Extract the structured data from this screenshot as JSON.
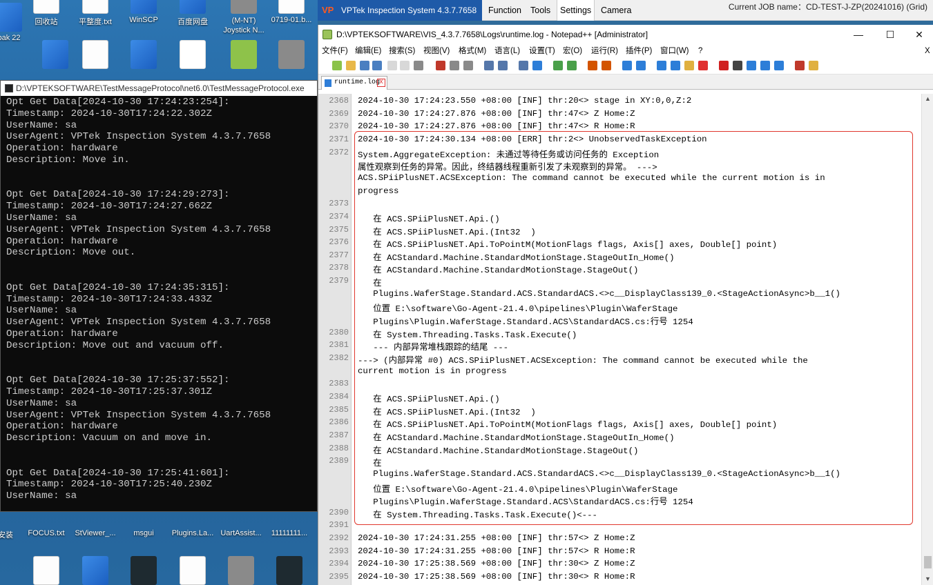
{
  "desktop": {
    "icons": [
      {
        "label": "bak\n22",
        "kind": "blue"
      },
      {
        "label": "回收站",
        "kind": "file"
      },
      {
        "label": "平整度.txt",
        "kind": "file"
      },
      {
        "label": "WinSCP",
        "kind": "blue"
      },
      {
        "label": "百度网盘",
        "kind": "blue"
      },
      {
        "label": "(M-NT)\nJoystick N...",
        "kind": "gray"
      },
      {
        "label": "0719-01.b...",
        "kind": "file"
      },
      {
        "label": "安装",
        "kind": "blue"
      },
      {
        "label": "FOCUS.txt",
        "kind": "file"
      },
      {
        "label": "StViewer_...",
        "kind": "blue"
      },
      {
        "label": "msgui",
        "kind": "dark"
      },
      {
        "label": "Plugins.La...",
        "kind": "file"
      },
      {
        "label": "UartAssist...",
        "kind": "gray"
      },
      {
        "label": "11111111...",
        "kind": "dark"
      }
    ]
  },
  "console": {
    "title": "D:\\VPTEKSOFTWARE\\TestMessageProtocol\\net6.0\\TestMessageProtocol.exe",
    "lines": [
      "Opt Get Data[2024-10-30 17:24:23:254]:",
      "Timestamp: 2024-10-30T17:24:22.302Z",
      "UserName: sa",
      "UserAgent: VPTek Inspection System 4.3.7.7658",
      "Operation: hardware",
      "Description: Move in.",
      "",
      "",
      "Opt Get Data[2024-10-30 17:24:29:273]:",
      "Timestamp: 2024-10-30T17:24:27.662Z",
      "UserName: sa",
      "UserAgent: VPTek Inspection System 4.3.7.7658",
      "Operation: hardware",
      "Description: Move out.",
      "",
      "",
      "Opt Get Data[2024-10-30 17:24:35:315]:",
      "Timestamp: 2024-10-30T17:24:33.433Z",
      "UserName: sa",
      "UserAgent: VPTek Inspection System 4.3.7.7658",
      "Operation: hardware",
      "Description: Move out and vacuum off.",
      "",
      "",
      "Opt Get Data[2024-10-30 17:25:37:552]:",
      "Timestamp: 2024-10-30T17:25:37.301Z",
      "UserName: sa",
      "UserAgent: VPTek Inspection System 4.3.7.7658",
      "Operation: hardware",
      "Description: Vacuum on and move in.",
      "",
      "",
      "Opt Get Data[2024-10-30 17:25:41:601]:",
      "Timestamp: 2024-10-30T17:25:40.230Z",
      "UserName: sa"
    ]
  },
  "vptek": {
    "title": "VPTek Inspection System 4.3.7.7658",
    "logo": "VP",
    "menus": [
      "Function",
      "Tools",
      "Settings",
      "Camera"
    ],
    "selected_menu": "Settings",
    "job": "Current JOB name：CD-TEST-J-ZP(20241016) (Grid)"
  },
  "npp": {
    "title": "D:\\VPTEKSOFTWARE\\VIS_4.3.7.7658\\Logs\\runtime.log - Notepad++ [Administrator]",
    "window_controls": [
      "—",
      "☐",
      "✕"
    ],
    "menu": [
      "文件(F)",
      "编辑(E)",
      "搜索(S)",
      "视图(V)",
      "格式(M)",
      "语言(L)",
      "设置(T)",
      "宏(O)",
      "运行(R)",
      "插件(P)",
      "窗口(W)",
      "?"
    ],
    "menu_close": "X",
    "tab": "runtime.log",
    "tab_close": "x"
  },
  "log": [
    {
      "n": "2368",
      "text": "2024-10-30 17:24:23.550 +08:00 [INF] thr:20<> stage in XY:0,0,Z:2"
    },
    {
      "n": "2369",
      "text": "2024-10-30 17:24:27.876 +08:00 [INF] thr:47<> Z Home:Z"
    },
    {
      "n": "2370",
      "text": "2024-10-30 17:24:27.876 +08:00 [INF] thr:47<> R Home:R"
    },
    {
      "n": "2371",
      "text": "2024-10-30 17:24:30.134 +08:00 [ERR] thr:2<> UnobservedTaskException"
    },
    {
      "n": "2372",
      "text": "System.AggregateException: 未通过等待任务或访问任务的 Exception"
    },
    {
      "n": "",
      "text": "属性观察到任务的异常。因此，终结器线程重新引发了未观察到的异常。 --->"
    },
    {
      "n": "",
      "text": "ACS.SPiiPlusNET.ACSException: The command cannot be executed while the current motion is in"
    },
    {
      "n": "",
      "text": "progress"
    },
    {
      "n": "2373",
      "text": ""
    },
    {
      "n": "2374",
      "text": "   在 ACS.SPiiPlusNET.Api.()"
    },
    {
      "n": "2375",
      "text": "   在 ACS.SPiiPlusNET.Api.(Int32  )"
    },
    {
      "n": "2376",
      "text": "   在 ACS.SPiiPlusNET.Api.ToPointM(MotionFlags flags, Axis[] axes, Double[] point)"
    },
    {
      "n": "2377",
      "text": "   在 ACStandard.Machine.StandardMotionStage.StageOutIn_Home()"
    },
    {
      "n": "2378",
      "text": "   在 ACStandard.Machine.StandardMotionStage.StageOut()"
    },
    {
      "n": "2379",
      "text": "   在"
    },
    {
      "n": "",
      "text": "   Plugins.WaferStage.Standard.ACS.StandardACS.<>c__DisplayClass139_0.<StageActionAsync>b__1()"
    },
    {
      "n": "",
      "text": "   位置 E:\\software\\Go-Agent-21.4.0\\pipelines\\Plugin\\WaferStage"
    },
    {
      "n": "",
      "text": "   Plugins\\Plugin.WaferStage.Standard.ACS\\StandardACS.cs:行号 1254"
    },
    {
      "n": "2380",
      "text": "   在 System.Threading.Tasks.Task.Execute()"
    },
    {
      "n": "2381",
      "text": "   --- 内部异常堆栈跟踪的结尾 ---"
    },
    {
      "n": "2382",
      "text": "---> (内部异常 #0) ACS.SPiiPlusNET.ACSException: The command cannot be executed while the"
    },
    {
      "n": "",
      "text": "current motion is in progress"
    },
    {
      "n": "2383",
      "text": ""
    },
    {
      "n": "2384",
      "text": "   在 ACS.SPiiPlusNET.Api.()"
    },
    {
      "n": "2385",
      "text": "   在 ACS.SPiiPlusNET.Api.(Int32  )"
    },
    {
      "n": "2386",
      "text": "   在 ACS.SPiiPlusNET.Api.ToPointM(MotionFlags flags, Axis[] axes, Double[] point)"
    },
    {
      "n": "2387",
      "text": "   在 ACStandard.Machine.StandardMotionStage.StageOutIn_Home()"
    },
    {
      "n": "2388",
      "text": "   在 ACStandard.Machine.StandardMotionStage.StageOut()"
    },
    {
      "n": "2389",
      "text": "   在"
    },
    {
      "n": "",
      "text": "   Plugins.WaferStage.Standard.ACS.StandardACS.<>c__DisplayClass139_0.<StageActionAsync>b__1()"
    },
    {
      "n": "",
      "text": "   位置 E:\\software\\Go-Agent-21.4.0\\pipelines\\Plugin\\WaferStage"
    },
    {
      "n": "",
      "text": "   Plugins\\Plugin.WaferStage.Standard.ACS\\StandardACS.cs:行号 1254"
    },
    {
      "n": "2390",
      "text": "   在 System.Threading.Tasks.Task.Execute()<---"
    },
    {
      "n": "2391",
      "text": ""
    },
    {
      "n": "2392",
      "text": "2024-10-30 17:24:31.255 +08:00 [INF] thr:57<> Z Home:Z"
    },
    {
      "n": "2393",
      "text": "2024-10-30 17:24:31.255 +08:00 [INF] thr:57<> R Home:R"
    },
    {
      "n": "2394",
      "text": "2024-10-30 17:25:38.569 +08:00 [INF] thr:30<> Z Home:Z"
    },
    {
      "n": "2395",
      "text": "2024-10-30 17:25:38.569 +08:00 [INF] thr:30<> R Home:R"
    }
  ]
}
